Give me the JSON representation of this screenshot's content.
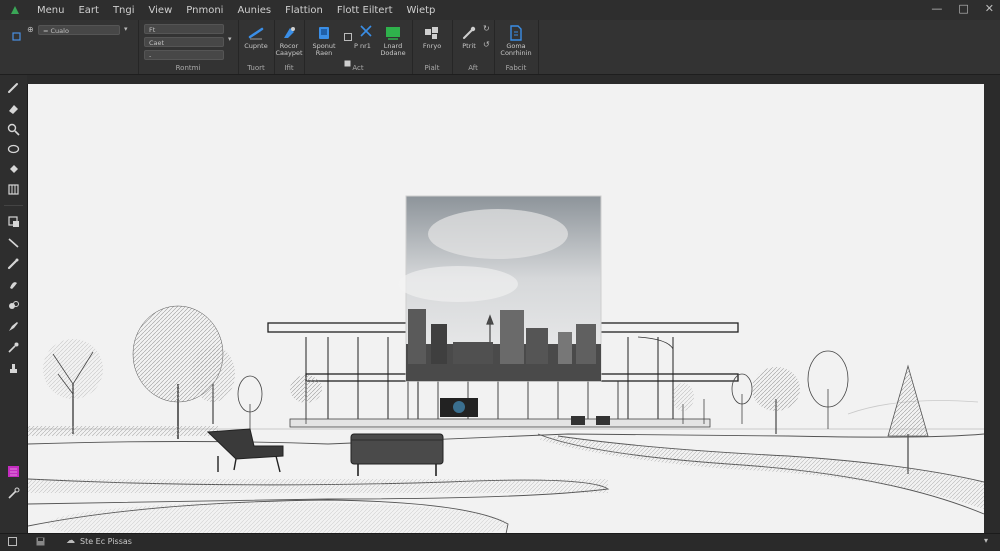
{
  "menu": {
    "items": [
      "Menu",
      "Eart",
      "Tngi",
      "View",
      "Pnmoni",
      "Aunies",
      "Flattion",
      "Flott Eiltert",
      "Wietp"
    ]
  },
  "ribbon": {
    "field_a": "= Cualo",
    "field_b": "Ft",
    "field_c": "Caet",
    "field_d": "-",
    "groups": [
      {
        "label": "Rontmi"
      },
      {
        "label": "Tuort"
      },
      {
        "label": "Ifit"
      },
      {
        "label": "Act"
      },
      {
        "label": "Pialt"
      },
      {
        "label": "Aft"
      },
      {
        "label": "Fabcit"
      }
    ],
    "buttons": [
      {
        "label": "Cupnte"
      },
      {
        "label": "Rocor Caaypet"
      },
      {
        "label": "Sponut Raen"
      },
      {
        "label": "P nr1"
      },
      {
        "label": "Lnard Dodane"
      },
      {
        "label": "Fnryo"
      },
      {
        "label": "Ptrit"
      },
      {
        "label": "Goma Conrhinin"
      }
    ]
  },
  "tools": [
    "pencil-icon",
    "eraser-icon",
    "magnify-icon",
    "lasso-icon",
    "bucket-icon",
    "ruler-icon",
    "transform-icon",
    "line-icon",
    "brush-icon",
    "smudge-icon",
    "clone-icon",
    "pen-icon",
    "eyedropper-icon",
    "stamp-icon",
    "color-swatch-icon",
    "settings-pen-icon"
  ],
  "status": {
    "text": "Ste Ec Pissas"
  },
  "colors": {
    "accent_blue": "#3a8ee6",
    "accent_green": "#2fb24c",
    "accent_magenta": "#c42cc0"
  }
}
